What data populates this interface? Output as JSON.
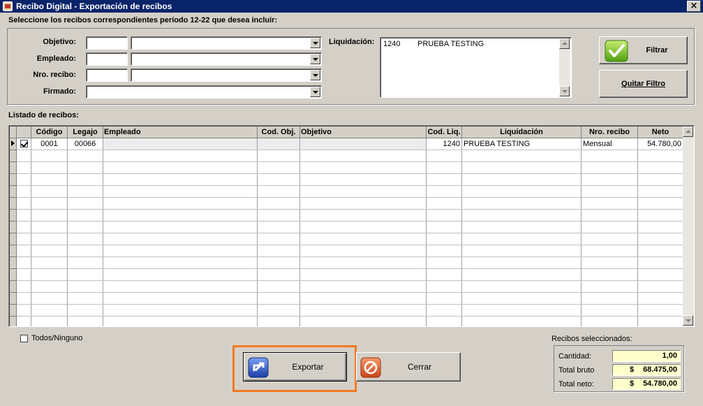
{
  "window": {
    "title": "Recibo Digital - Exportación de recibos",
    "close": "×"
  },
  "instruction": "Seleccione los recibos correspondientes período 12-22 que desea incluir:",
  "filters": {
    "objetivo_label": "Objetivo:",
    "empleado_label": "Empleado:",
    "nro_recibo_label": "Nro. recibo:",
    "firmado_label": "Firmado:",
    "liquidacion_label": "Liquidación:"
  },
  "liquidacion_list": [
    {
      "code": "1240",
      "name": "PRUEBA TESTING"
    }
  ],
  "buttons": {
    "filtrar": "Filtrar",
    "quitar_filtro": "Quitar Filtro",
    "exportar": "Exportar",
    "cerrar": "Cerrar"
  },
  "listado_label": "Listado de recibos:",
  "table": {
    "columns": [
      "Código",
      "Legajo",
      "Empleado",
      "Cod. Obj.",
      "Objetivo",
      "Cod. Liq.",
      "Liquidación",
      "Nro. recibo",
      "Neto"
    ],
    "rows": [
      {
        "checked": true,
        "codigo": "0001",
        "legajo": "00066",
        "empleado": "",
        "cod_obj": "",
        "objetivo": "",
        "cod_liq": "1240",
        "liquidacion": "PRUEBA TESTING",
        "nro_recibo": "Mensual",
        "neto": "54.780,00"
      }
    ]
  },
  "todos_label": "Todos/Ninguno",
  "summary": {
    "title": "Recibos seleccionados:",
    "cantidad_label": "Cantidad:",
    "cantidad": "1,00",
    "bruto_label": "Total bruto",
    "bruto_currency": "$",
    "bruto": "68.475,00",
    "neto_label": "Total neto:",
    "neto_currency": "$",
    "neto": "54.780,00"
  },
  "colors": {
    "title_bar": "#0a246a",
    "highlight": "#f47920",
    "summary_field": "#ffffcc"
  }
}
